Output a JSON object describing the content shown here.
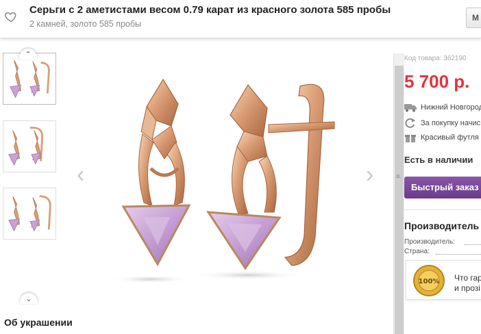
{
  "header": {
    "title": "Серьги с 2 аметистами весом 0.79 карат из красного золота 585 пробы",
    "subtitle": "2 камней, золото 585 пробы",
    "button_label": "М"
  },
  "thumbnails": {
    "up_icon": "chevron-up",
    "down_icon": "chevron-down",
    "count": 3
  },
  "gallery": {
    "prev_icon": "‹",
    "next_icon": "›"
  },
  "about": {
    "title": "Об украшении"
  },
  "product": {
    "sku": "Код товара: 362190",
    "price": "5 700 р.",
    "delivery": "Нижний Новгород",
    "bonus": "За покупку начис",
    "gift": "Красивый футля",
    "stock": "Есть в наличии",
    "quick_order": "Быстрый заказ"
  },
  "manufacturer": {
    "title": "Производитель",
    "maker_label": "Производитель:",
    "country_label": "Страна:"
  },
  "guarantee": {
    "line1": "Что гар",
    "line2": "и прозі"
  },
  "colors": {
    "price": "#e2333c",
    "button": "#7a4a9a",
    "gold": "#d9a07a",
    "amethyst": "#c9a2d6"
  }
}
